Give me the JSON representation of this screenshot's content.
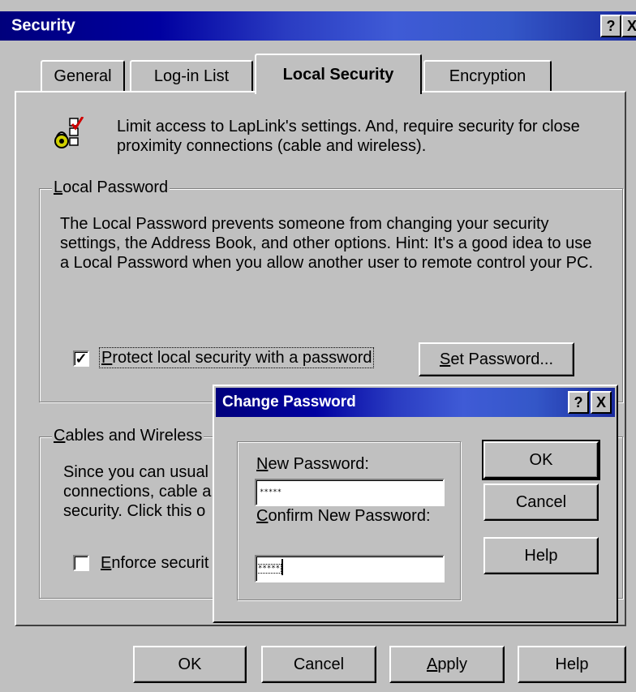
{
  "main_window": {
    "title": "Security",
    "help_btn": "?",
    "close_btn": "X",
    "tabs": [
      {
        "label": "General"
      },
      {
        "label": "Log-in List"
      },
      {
        "label": "Local Security"
      },
      {
        "label": "Encryption"
      }
    ],
    "intro": {
      "text": "Limit access to LapLink's settings.  And, require security for close proximity connections (cable and wireless)."
    },
    "local_password": {
      "legend_mnemonic": "L",
      "legend_rest": "ocal Password",
      "description": "The Local Password prevents someone from changing your security settings, the Address Book, and other options.  Hint: It's a good idea to use a Local Password when you allow another user to remote control your PC.",
      "checkbox_mnemonic": "P",
      "checkbox_rest": "rotect local security with a password",
      "checkbox_checked": true,
      "checkbox_mark": "✓",
      "set_password_mnemonic": "S",
      "set_password_rest": "et Password..."
    },
    "cables": {
      "legend_mnemonic": "C",
      "legend_rest": "ables and Wireless",
      "line1": "Since you can usual",
      "line2": "connections, cable a",
      "line3": "security.  Click this o",
      "checkbox_mnemonic": "E",
      "checkbox_rest": "nforce securit",
      "checkbox_checked": false
    },
    "buttons": {
      "ok": "OK",
      "cancel": "Cancel",
      "apply_mnemonic": "A",
      "apply_rest": "pply",
      "help": "Help"
    }
  },
  "change_password": {
    "title": "Change Password",
    "help_btn": "?",
    "close_btn": "X",
    "new_label_mnemonic": "N",
    "new_label_rest": "ew Password:",
    "new_value": "*****",
    "confirm_label_mnemonic": "C",
    "confirm_label_rest": "onfirm New Password:",
    "confirm_value": "*****",
    "ok": "OK",
    "cancel": "Cancel",
    "help": "Help"
  }
}
